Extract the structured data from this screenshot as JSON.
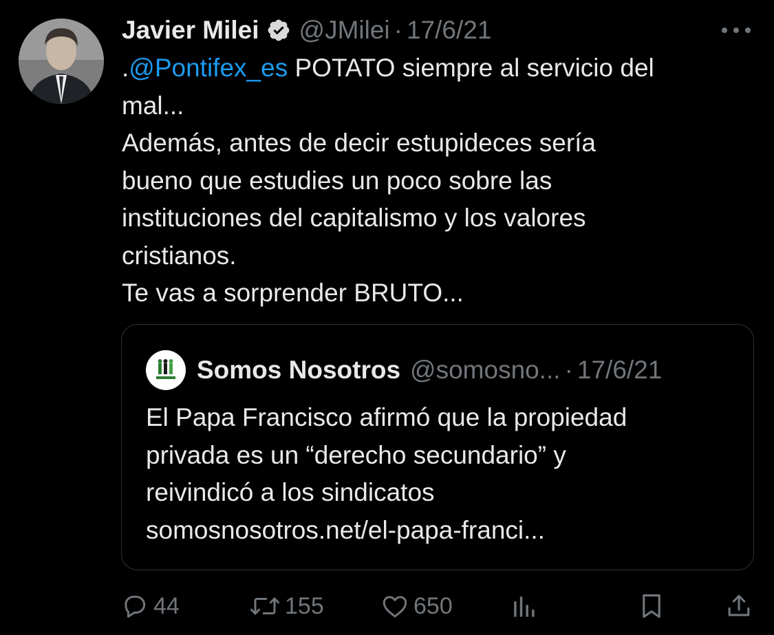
{
  "tweet": {
    "author": {
      "display_name": "Javier Milei",
      "handle": "@JMilei",
      "verified": true,
      "avatar_icon": "profile-photo"
    },
    "separator": "·",
    "date": "17/6/21",
    "more_icon": "ellipsis-icon",
    "text": {
      "line1_prefix": ".",
      "line1_mention": "@Pontifex_es",
      "line1_rest": " POTATO siempre al servicio del",
      "line2": "mal...",
      "line3": "Además, antes de decir estupideces sería",
      "line4": "bueno que estudies un poco sobre las",
      "line5": "instituciones del capitalismo y los valores",
      "line6": "cristianos.",
      "line7": "Te vas a sorprender BRUTO..."
    }
  },
  "quoted_tweet": {
    "display_name": "Somos Nosotros",
    "handle": "@somosno...",
    "separator": "·",
    "date": "17/6/21",
    "avatar_icon": "somos-nosotros-logo",
    "text": {
      "line1": "El Papa Francisco afirmó que la propiedad",
      "line2": "privada es un “derecho secundario” y",
      "line3": "reivindicó a los sindicatos",
      "line4": "somosnosotros.net/el-papa-franci..."
    }
  },
  "actions": {
    "reply_icon": "reply-icon",
    "reply_count": "44",
    "retweet_icon": "retweet-icon",
    "retweet_count": "155",
    "like_icon": "heart-icon",
    "like_count": "650",
    "views_icon": "views-icon",
    "bookmark_icon": "bookmark-icon",
    "share_icon": "share-icon"
  },
  "colors": {
    "background": "#000000",
    "primary_text": "#e7e9ea",
    "secondary_text": "#71767b",
    "link": "#1d9bf0",
    "verified_badge": "#d9d9d9",
    "border": "#2f3336"
  }
}
